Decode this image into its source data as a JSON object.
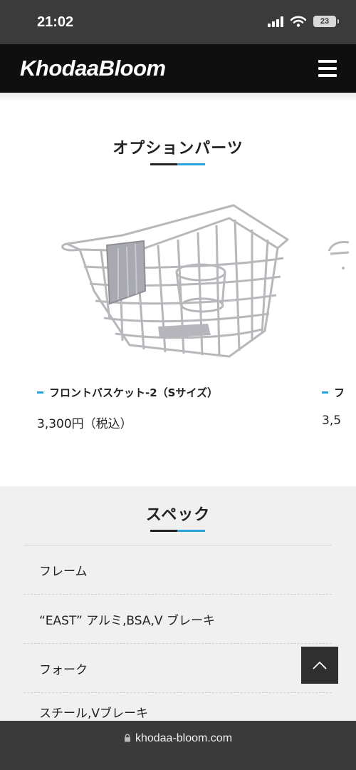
{
  "status_bar": {
    "time": "21:02",
    "battery": "23",
    "icons": [
      "cellular-signal-icon",
      "wifi-icon",
      "battery-icon"
    ]
  },
  "header": {
    "logo": "KhodaaBloom",
    "menu_icon": "hamburger-menu-icon"
  },
  "options_section": {
    "title": "オプションパーツ",
    "products": [
      {
        "name": "フロントバスケット-2（Sサイズ）",
        "price": "3,300円（税込）"
      },
      {
        "name": "フ",
        "price": "3,5"
      }
    ]
  },
  "spec_section": {
    "title": "スペック",
    "rows": [
      "フレーム",
      "“EAST” アルミ,BSA,V ブレーキ",
      "フォーク",
      "スチール,Vブレーキ"
    ]
  },
  "scroll_top": {
    "icon": "chevron-up-icon"
  },
  "bottom_bar": {
    "url": "khodaa-bloom.com",
    "icon": "lock-icon"
  },
  "colors": {
    "accent": "#29a3d9",
    "header_bg": "#0f0f0f",
    "spec_bg": "#f0f0f0"
  }
}
